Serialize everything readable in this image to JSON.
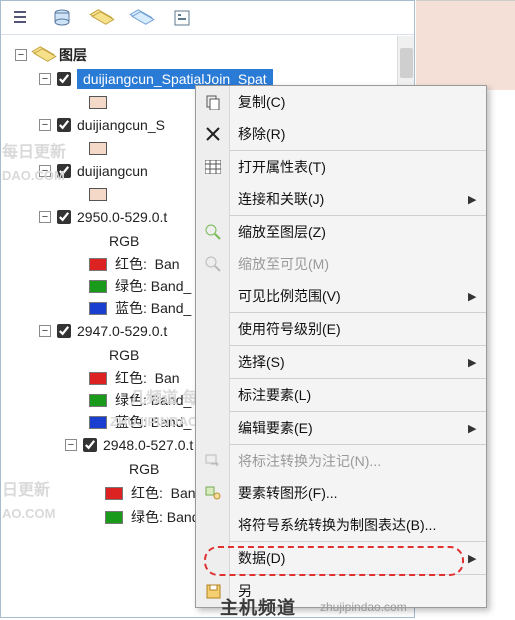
{
  "toolbar": {
    "tooltips": [
      "list",
      "db",
      "layers",
      "addlayer",
      "options"
    ]
  },
  "tree": {
    "root_label": "图层",
    "layers": [
      {
        "name": "duijiangcun_SpatialJoin_Spat",
        "selected": true
      },
      {
        "name": "duijiangcun_S"
      },
      {
        "name": "duijiangcun"
      }
    ],
    "rasters": [
      {
        "name": "2950.0-529.0.t",
        "rgb_label": "RGB",
        "bands": [
          {
            "color": "red",
            "label": "红色:",
            "val": "Ban"
          },
          {
            "color": "green",
            "label": "绿色:",
            "val": "Band_"
          },
          {
            "color": "blue",
            "label": "蓝色:",
            "val": "Band_"
          }
        ]
      },
      {
        "name": "2947.0-529.0.t",
        "rgb_label": "RGB",
        "bands": [
          {
            "color": "red",
            "label": "红色:",
            "val": "Ban"
          },
          {
            "color": "green",
            "label": "绿色:",
            "val": "Band_"
          },
          {
            "color": "blue",
            "label": "蓝色:",
            "val": "Band_"
          }
        ]
      },
      {
        "name": "2948.0-527.0.t",
        "rgb_label": "RGB",
        "bands": [
          {
            "color": "red",
            "label": "红色:",
            "val": "Ban"
          },
          {
            "color": "green",
            "label": "绿色:",
            "val": "Band_"
          }
        ]
      }
    ]
  },
  "menu": {
    "items": [
      {
        "label": "复制(C)",
        "icon": "copy",
        "sub": false
      },
      {
        "label": "移除(R)",
        "icon": "remove",
        "sub": false
      },
      {
        "sep": true
      },
      {
        "label": "打开属性表(T)",
        "icon": "table",
        "sub": false
      },
      {
        "label": "连接和关联(J)",
        "icon": "",
        "sub": true
      },
      {
        "sep": true
      },
      {
        "label": "缩放至图层(Z)",
        "icon": "zoom",
        "sub": false
      },
      {
        "label": "缩放至可见(M)",
        "icon": "zoomdis",
        "sub": false,
        "disabled": true
      },
      {
        "label": "可见比例范围(V)",
        "icon": "",
        "sub": true
      },
      {
        "sep": true
      },
      {
        "label": "使用符号级别(E)",
        "icon": "",
        "sub": false
      },
      {
        "sep": true
      },
      {
        "label": "选择(S)",
        "icon": "",
        "sub": true
      },
      {
        "sep": true
      },
      {
        "label": "标注要素(L)",
        "icon": "",
        "sub": false
      },
      {
        "sep": true
      },
      {
        "label": "编辑要素(E)",
        "icon": "",
        "sub": true
      },
      {
        "sep": true
      },
      {
        "label": "将标注转换为注记(N)...",
        "icon": "convdis",
        "sub": false,
        "disabled": true
      },
      {
        "label": "要素转图形(F)...",
        "icon": "feat",
        "sub": false
      },
      {
        "label": "将符号系统转换为制图表达(B)...",
        "icon": "",
        "sub": false
      },
      {
        "sep": true
      },
      {
        "label": "数据(D)",
        "icon": "",
        "sub": true
      },
      {
        "sep": true
      },
      {
        "label": "另",
        "icon": "save",
        "sub": false
      }
    ]
  },
  "watermarks": {
    "a": "主机频道 每",
    "b": "ZHUJIPINDAO",
    "c": "每日更新",
    "d": "DAO.COM",
    "e": "几频道 每",
    "f": "ZHUJIPINDAO",
    "g": "日更新",
    "h": "AO.COM",
    "footer": "主机频道",
    "footerurl": "zhujipindao.com"
  }
}
